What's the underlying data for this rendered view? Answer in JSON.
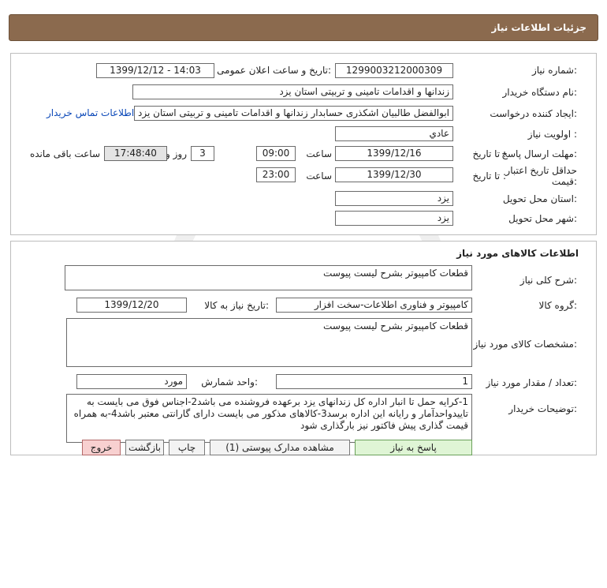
{
  "header": {
    "title": "جزئیات اطلاعات نیاز"
  },
  "info": {
    "need_number_label": "شماره نیاز:",
    "need_number": "1299003212000309",
    "announce_label": "تاریخ و ساعت اعلان عمومی:",
    "announce_value": "1399/12/12 - 14:03",
    "buyer_org_label": "نام دستگاه خریدار:",
    "buyer_org": "زندانها و اقدامات تامینی و تربیتی استان یزد",
    "creator_label": "ایجاد کننده درخواست:",
    "creator": "ابوالفضل  طالبیان اشکذری حسابدار زندانها و اقدامات تامینی و تربیتی استان یزد",
    "contact_link": "اطلاعات تماس خریدار",
    "priority_label": "اولویت نیاز :",
    "priority": "عادي",
    "deadline_label": "مهلت ارسال پاسخ:",
    "until_label": "تا تاریخ :",
    "deadline_date": "1399/12/16",
    "time_label": "ساعت",
    "deadline_time": "09:00",
    "days_value": "3",
    "days_label": "روز و",
    "remaining_time": "17:48:40",
    "remaining_label": "ساعت باقی مانده",
    "validity_label_1": "حداقل تاریخ اعتبار",
    "validity_label_2": "قیمت:",
    "validity_until_label": "تا تاریخ :",
    "validity_date": "1399/12/30",
    "validity_time_label": "ساعت",
    "validity_time": "23:00",
    "province_label": "استان محل تحویل:",
    "province": "یزد",
    "city_label": "شهر محل تحویل:",
    "city": "یزد"
  },
  "goods": {
    "section_title": "اطلاعات کالاهای مورد نیاز",
    "general_desc_label": "شرح کلی نیاز:",
    "general_desc": "قطعات کامپیوتر بشرح لیست پیوست",
    "group_label": "گروه کالا:",
    "group": "کامپیوتر و فناوری اطلاعات-سخت افزار",
    "need_date_label": "تاریخ نیاز به کالا:",
    "need_date": "1399/12/20",
    "spec_label": "مشخصات کالای مورد نیاز:",
    "spec": "قطعات کامپیوتر بشرح لیست پیوست",
    "qty_label": "تعداد / مقدار مورد نیاز:",
    "qty": "1",
    "unit_label": "واحد شمارش:",
    "unit": "مورد",
    "buyer_notes_label": "توضیحات خریدار:",
    "buyer_notes": "1-کرایه حمل تا انبار اداره کل زندانهای یزد برعهده فروشنده می باشد2-اجناس فوق می بایست به تاییدواحدآمار و رایانه این اداره برسد3-کالاهای مذکور می بایست دارای گارانتی معتبر باشد4-به همراه قیمت گذاری پیش فاکتور نیز بارگذاری شود"
  },
  "buttons": {
    "reply": "پاسخ به نیاز",
    "attachments": "مشاهده مدارک پیوستی (1)",
    "print": "چاپ",
    "back": "بازگشت",
    "exit": "خروج"
  },
  "colors": {
    "header_bg": "#8b6a4e",
    "link": "#0b48b8",
    "reply_button": "#dff5d5",
    "exit_button": "#f8d0d0"
  }
}
